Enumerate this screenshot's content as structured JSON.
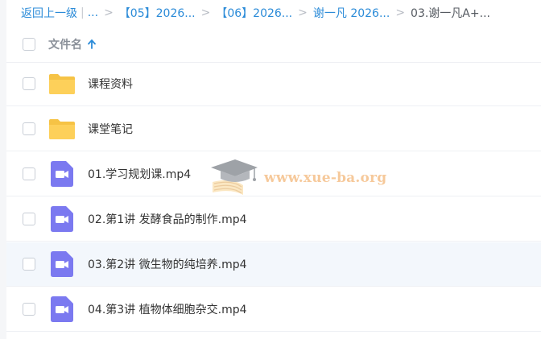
{
  "breadcrumb": {
    "back_label": "返回上一级",
    "ellipsis": "...",
    "items": [
      "【05】2026...",
      "【06】2026...",
      "谢一凡 2026..."
    ],
    "current": "03.谢一凡A+...",
    "separator": ">"
  },
  "header": {
    "filename_label": "文件名",
    "sort_icon": "arrow-up-icon"
  },
  "files": [
    {
      "name": "课程资料",
      "type": "folder",
      "icon": "folder-icon"
    },
    {
      "name": "课堂笔记",
      "type": "folder",
      "icon": "folder-icon"
    },
    {
      "name": "01.学习规划课.mp4",
      "type": "video",
      "icon": "video-file-icon"
    },
    {
      "name": "02.第1讲 发酵食品的制作.mp4",
      "type": "video",
      "icon": "video-file-icon"
    },
    {
      "name": "03.第2讲 微生物的纯培养.mp4",
      "type": "video",
      "icon": "video-file-icon"
    },
    {
      "name": "04.第3讲 植物体细胞杂交.mp4",
      "type": "video",
      "icon": "video-file-icon"
    }
  ],
  "watermark": {
    "text": "www.xue-ba.org"
  },
  "colors": {
    "link": "#2b8bd8",
    "folder": "#fdd05a",
    "video": "#7b79f0",
    "row_hover": "#f3f7fc"
  }
}
